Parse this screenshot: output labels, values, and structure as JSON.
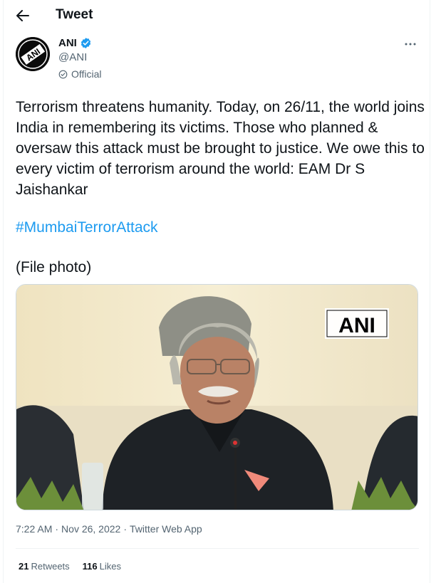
{
  "header": {
    "title": "Tweet",
    "back_icon": "arrow-left-icon"
  },
  "author": {
    "avatar_text": "ANI",
    "name": "ANI",
    "verified_icon": "verified-badge-icon",
    "handle": "@ANI",
    "label": "Official",
    "label_icon": "official-check-icon",
    "more_icon": "more-horizontal-icon"
  },
  "tweet": {
    "text": "Terrorism threatens humanity. Today, on 26/11, the world joins India in remembering its victims. Those who planned & oversaw this attack must be brought to justice. We owe this to every victim of terrorism around the world: EAM Dr S Jaishankar",
    "hashtag": "#MumbaiTerrorAttack",
    "note": "(File photo)"
  },
  "media": {
    "watermark": "ANI"
  },
  "meta": {
    "time": "7:22 AM",
    "separator1": "·",
    "date": "Nov 26, 2022",
    "separator2": "·",
    "source": "Twitter Web App"
  },
  "stats": {
    "retweets_count": "21",
    "retweets_label": "Retweets",
    "likes_count": "116",
    "likes_label": "Likes"
  },
  "colors": {
    "accent": "#1d9bf0",
    "text": "#0f1419",
    "secondary": "#536471",
    "divider": "#eff3f4"
  }
}
